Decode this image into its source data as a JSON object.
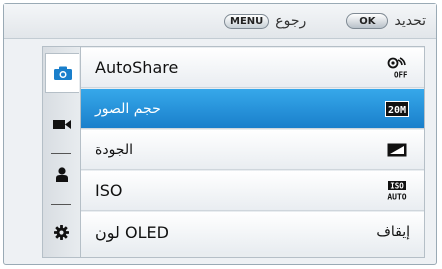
{
  "top_bar": {
    "ok_button": "OK",
    "ok_text": "تحديد",
    "menu_button": "MENU",
    "menu_text": "رجوع"
  },
  "sidebar": {
    "items": [
      {
        "icon": "camera-icon"
      },
      {
        "icon": "video-icon"
      },
      {
        "icon": "person-icon"
      },
      {
        "icon": "gear-icon"
      }
    ]
  },
  "menu": {
    "items": [
      {
        "label": "AutoShare",
        "value_icon": "autoshare-off-icon",
        "selected": false
      },
      {
        "label": "حجم الصور",
        "value_icon": "size-20m-icon",
        "value_icon_text": "20M",
        "selected": true
      },
      {
        "label": "الجودة",
        "value_icon": "quality-superfine-icon",
        "selected": false
      },
      {
        "label": "ISO",
        "value_icon": "iso-auto-icon",
        "value_icon_text_top": "ISO",
        "value_icon_text_bottom": "AUTO",
        "selected": false
      },
      {
        "label": "لون OLED",
        "value_text": "إيقاف",
        "selected": false
      }
    ]
  },
  "colors": {
    "selected_row": "#2195de",
    "accent_icon": "#1a7fcb"
  }
}
